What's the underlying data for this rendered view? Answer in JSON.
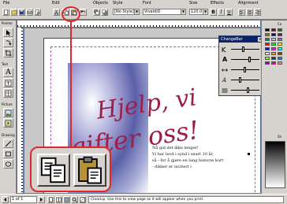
{
  "toolbar": {
    "file_label": "File",
    "edit_label": "Edit",
    "objects_label": "Objects",
    "style_label": "Style",
    "font_label": "Font",
    "size_label": "Size",
    "effects_label": "Effects",
    "alignment_label": "Alignment",
    "style_value": "[No Style]",
    "font_value": "VivaldiD",
    "size_value": "120.0",
    "bold_label": "B",
    "italic_label": "I",
    "underline_label": "U"
  },
  "toolbox": {
    "pointer_label": "Pointer",
    "text_label": "Text",
    "picture_label": "Picture",
    "drawing_label": "Drawing",
    "text_tool_glyph": "A"
  },
  "changebar": {
    "title": "ChangeBar",
    "close_glyph": "x",
    "row_glyph_1": "A",
    "row_glyph_2": "A"
  },
  "document": {
    "headline_line1": "Hjelp, vi",
    "headline_line2": "gifter oss!",
    "body_lines": [
      "Nå gid det ikke lenger!",
      "Vi har levd i synd i snart 10 år,",
      "så - for å gjøre en lang historie kort",
      "- dikker er invitert i"
    ]
  },
  "colors_palette_label": "Co",
  "shades_label": "Sh",
  "status": {
    "page_indicator": "1 of 1",
    "tip": "ClearLip. Use this to view page as it will appear when you print."
  },
  "palette_colors": [
    "#000000",
    "#800000",
    "#008000",
    "#808000",
    "#000080",
    "#800080",
    "#008080",
    "#c0c0c0",
    "#808080",
    "#ff0000",
    "#00ff00",
    "#ffff00",
    "#0000ff",
    "#ff00ff",
    "#00ffff",
    "#ffffff",
    "#ff8040",
    "#804000",
    "#80ff00",
    "#004040",
    "#0080ff",
    "#8000ff",
    "#ff0080",
    "#ff8080"
  ],
  "accent_colors": {
    "callout_ring": "#e0272d",
    "window_bg": "#5c6f9f",
    "chrome": "#d6d3ce"
  }
}
